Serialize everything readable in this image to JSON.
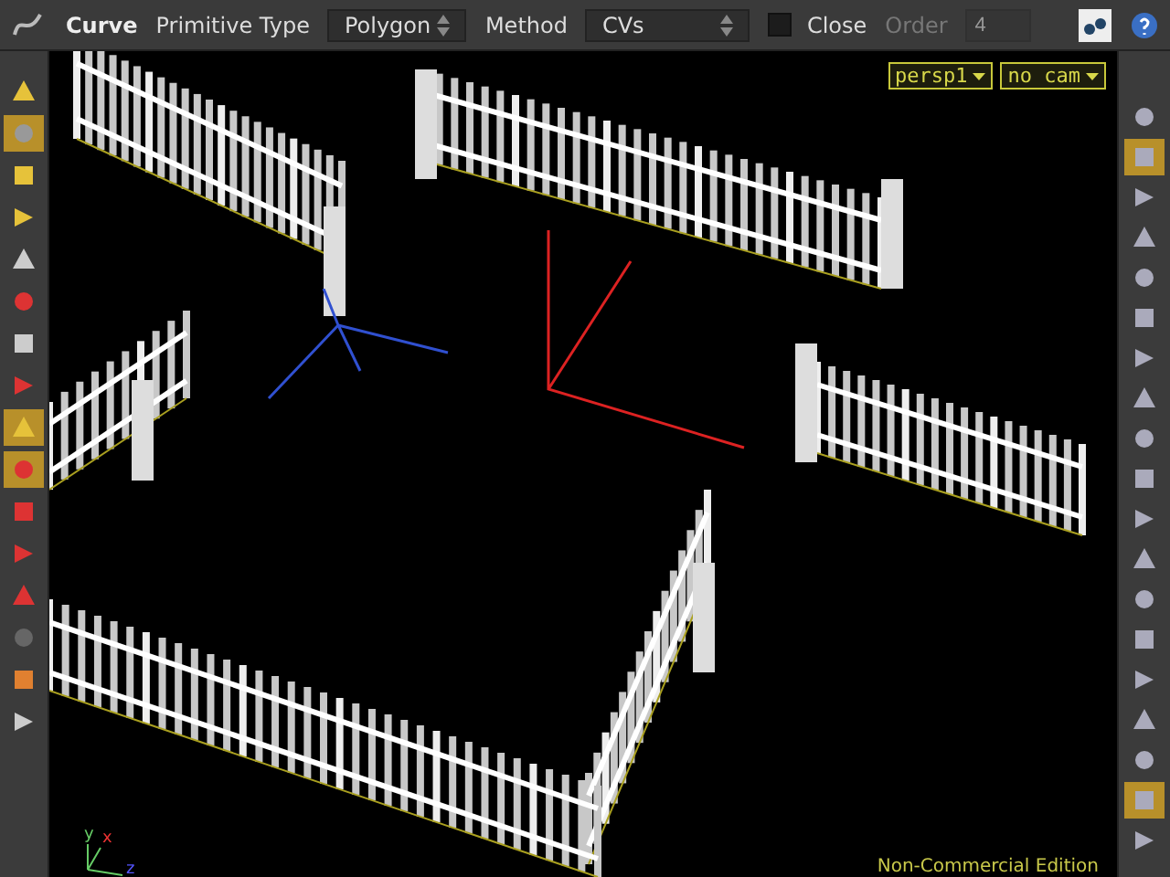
{
  "toolbar": {
    "title": "Curve",
    "primitive_type": {
      "label": "Primitive Type",
      "value": "Polygon"
    },
    "method": {
      "label": "Method",
      "value": "CVs"
    },
    "close": {
      "label": "Close",
      "checked": false
    },
    "order": {
      "label": "Order",
      "value": "4",
      "disabled": true
    }
  },
  "left_tools": [
    {
      "selected": false
    },
    {
      "selected": true
    },
    {
      "selected": false
    },
    {
      "selected": false
    },
    {
      "selected": false
    },
    {
      "selected": false
    },
    {
      "selected": false
    },
    {
      "selected": false
    },
    {
      "selected": true
    },
    {
      "selected": true
    },
    {
      "selected": false
    },
    {
      "selected": false
    },
    {
      "selected": false
    },
    {
      "selected": false
    },
    {
      "selected": false
    },
    {
      "selected": false
    }
  ],
  "right_tools": [
    {
      "selected": false
    },
    {
      "selected": true
    },
    {
      "selected": false
    },
    {
      "selected": false
    },
    {
      "selected": false
    },
    {
      "selected": false
    },
    {
      "selected": false
    },
    {
      "selected": false
    },
    {
      "selected": false
    },
    {
      "selected": false
    },
    {
      "selected": false
    },
    {
      "selected": false
    },
    {
      "selected": false
    },
    {
      "selected": false
    },
    {
      "selected": false
    },
    {
      "selected": false
    },
    {
      "selected": false
    },
    {
      "selected": true
    },
    {
      "selected": false
    }
  ],
  "viewport": {
    "camera": "persp1",
    "cam_menu": "no cam",
    "axes": [
      "x",
      "y",
      "z"
    ],
    "footer": "Non-Commercial Edition"
  }
}
